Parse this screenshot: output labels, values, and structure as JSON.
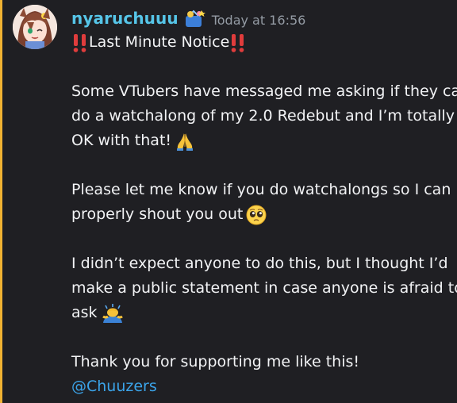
{
  "message": {
    "author": "nyaruchuuu",
    "timestamp": "Today at 16:56",
    "title": "Last Minute Notice",
    "lines": {
      "p1a": "Some VTubers have messaged me asking if they can",
      "p1b": "do a watchalong of my 2.0 Redebut and I’m totally",
      "p1c": "OK with that!",
      "p2a": "Please let me know if you do watchalongs so I can",
      "p2b": "properly shout you out",
      "p3a": "I didn’t expect anyone to do this, but I thought I’d",
      "p3b": "make a public statement in case anyone is afraid to",
      "p3c": "ask",
      "p4a": "Thank you for supporting me like this!"
    },
    "mention": "@Chuuzers"
  },
  "icons": {
    "badge": "role-badge-icon",
    "title_emoji": "double-exclamation-icon",
    "pray": "folded-hands-icon",
    "pleading": "pleading-face-icon",
    "bow": "person-bowing-icon"
  },
  "colors": {
    "background": "#1f1f23",
    "accent_bar": "#f0b232",
    "username": "#56c5e8",
    "mention": "#3ba4ea",
    "timestamp": "#949ba4",
    "text": "#f2f3f5"
  }
}
